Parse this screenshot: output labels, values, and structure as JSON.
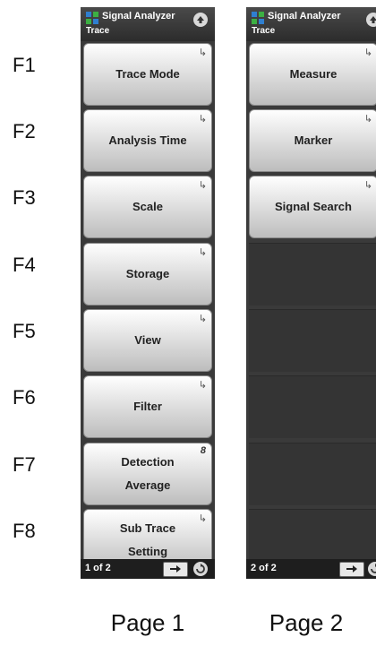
{
  "function_keys": [
    "F1",
    "F2",
    "F3",
    "F4",
    "F5",
    "F6",
    "F7",
    "F8"
  ],
  "page1": {
    "app_title": "Signal Analyzer",
    "menu_title": "Trace",
    "keys": [
      {
        "label": "Trace Mode",
        "marker": "↳"
      },
      {
        "label": "Analysis Time",
        "marker": "↳"
      },
      {
        "label": "Scale",
        "marker": "↳"
      },
      {
        "label": "Storage",
        "marker": "↳"
      },
      {
        "label": "View",
        "marker": "↳"
      },
      {
        "label": "Filter",
        "marker": "↳"
      },
      {
        "label_line1": "Detection",
        "label_line2": "Average",
        "marker": "8"
      },
      {
        "label_line1": "Sub Trace",
        "label_line2": "Setting",
        "marker": "↳"
      }
    ],
    "page_indicator": "1 of 2",
    "caption": "Page 1"
  },
  "page2": {
    "app_title": "Signal Analyzer",
    "menu_title": "Trace",
    "keys": [
      {
        "label": "Measure",
        "marker": "↳"
      },
      {
        "label": "Marker",
        "marker": "↳"
      },
      {
        "label": "Signal Search",
        "marker": "↳"
      }
    ],
    "page_indicator": "2 of 2",
    "caption": "Page 2"
  },
  "icons": {
    "app": "signal-analyzer-icon",
    "up": "up-arrow-icon",
    "next": "right-arrow-icon",
    "back": "return-icon"
  },
  "colors": {
    "panel_bg": "#3a3a3a",
    "key_light": "#ffffff",
    "key_dark": "#bdbdbd",
    "icon_blue": "#2f7fd0",
    "icon_green": "#3cb043"
  }
}
